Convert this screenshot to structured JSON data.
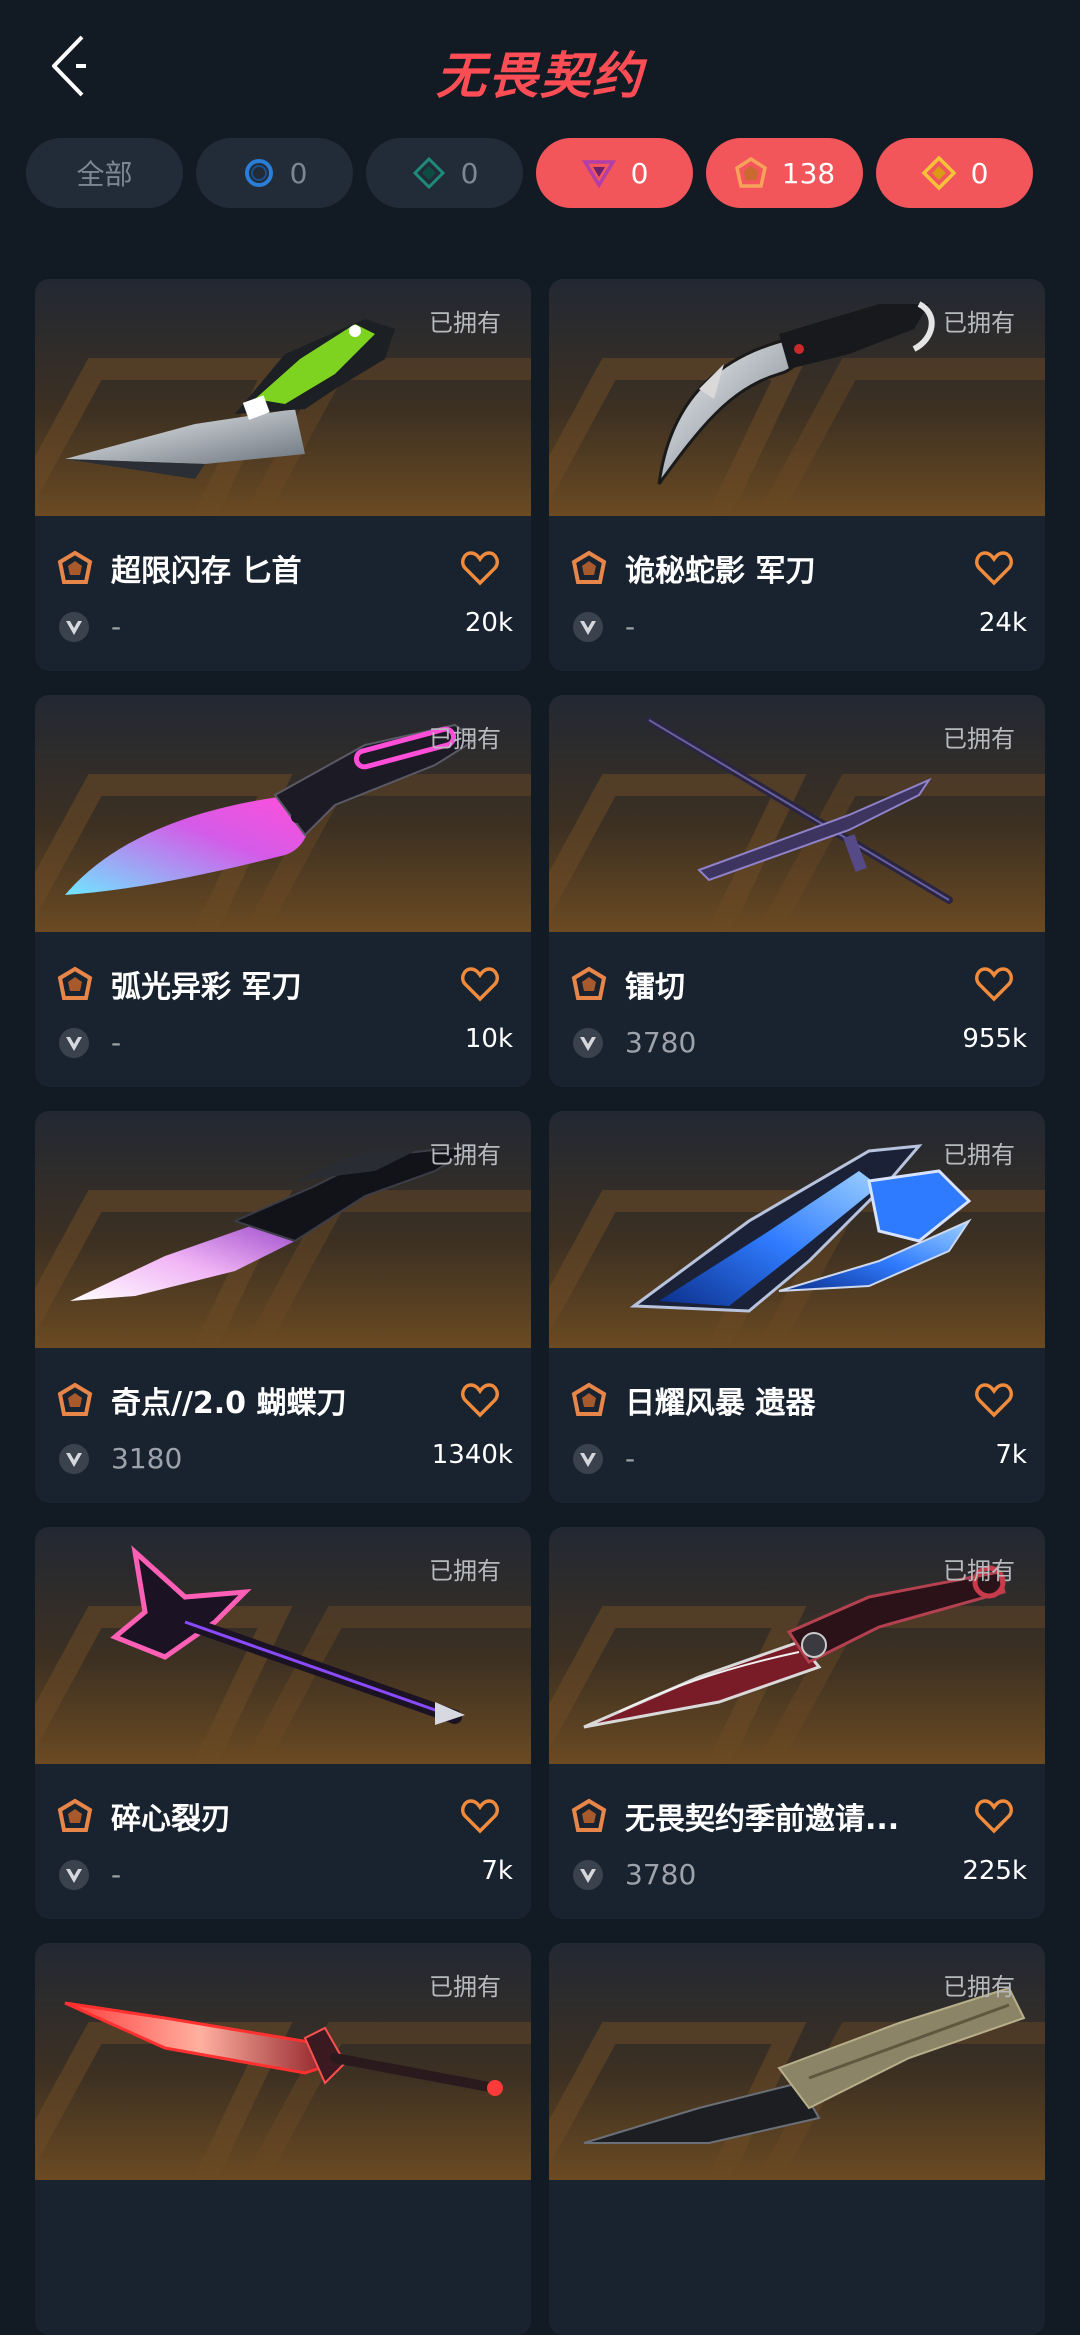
{
  "header": {
    "title": "无畏契约"
  },
  "filters": [
    {
      "label": "全部",
      "icon": "none",
      "active": false
    },
    {
      "label": "0",
      "icon": "blue-ring-icon",
      "active": false
    },
    {
      "label": "0",
      "icon": "teal-diamond-icon",
      "active": false
    },
    {
      "label": "0",
      "icon": "purple-triangle-icon",
      "active": true
    },
    {
      "label": "138",
      "icon": "orange-pentagon-icon",
      "active": true
    },
    {
      "label": "0",
      "icon": "gold-diamond-icon",
      "active": true
    }
  ],
  "owned_label": "已拥有",
  "items": [
    {
      "name": "超限闪存 匕首",
      "price": "-",
      "count": "20k"
    },
    {
      "name": "诡秘蛇影 军刀",
      "price": "-",
      "count": "24k"
    },
    {
      "name": "弧光异彩 军刀",
      "price": "-",
      "count": "10k"
    },
    {
      "name": "镭切",
      "price": "3780",
      "count": "955k"
    },
    {
      "name": "奇点//2.0 蝴蝶刀",
      "price": "3180",
      "count": "1340k"
    },
    {
      "name": "日耀风暴 遗器",
      "price": "-",
      "count": "7k"
    },
    {
      "name": "碎心裂刃",
      "price": "-",
      "count": "7k"
    },
    {
      "name": "无畏契约季前邀请...",
      "price": "3780",
      "count": "225k"
    },
    {
      "name": "",
      "price": "",
      "count": ""
    },
    {
      "name": "",
      "price": "",
      "count": ""
    }
  ],
  "colors": {
    "background": "#121a24",
    "card": "#19232f",
    "chip": "#222c38",
    "chip_active": "#f2555a",
    "accent": "#ff4d56",
    "tier_orange": "#e8864a",
    "heart_orange": "#f08a3c"
  }
}
